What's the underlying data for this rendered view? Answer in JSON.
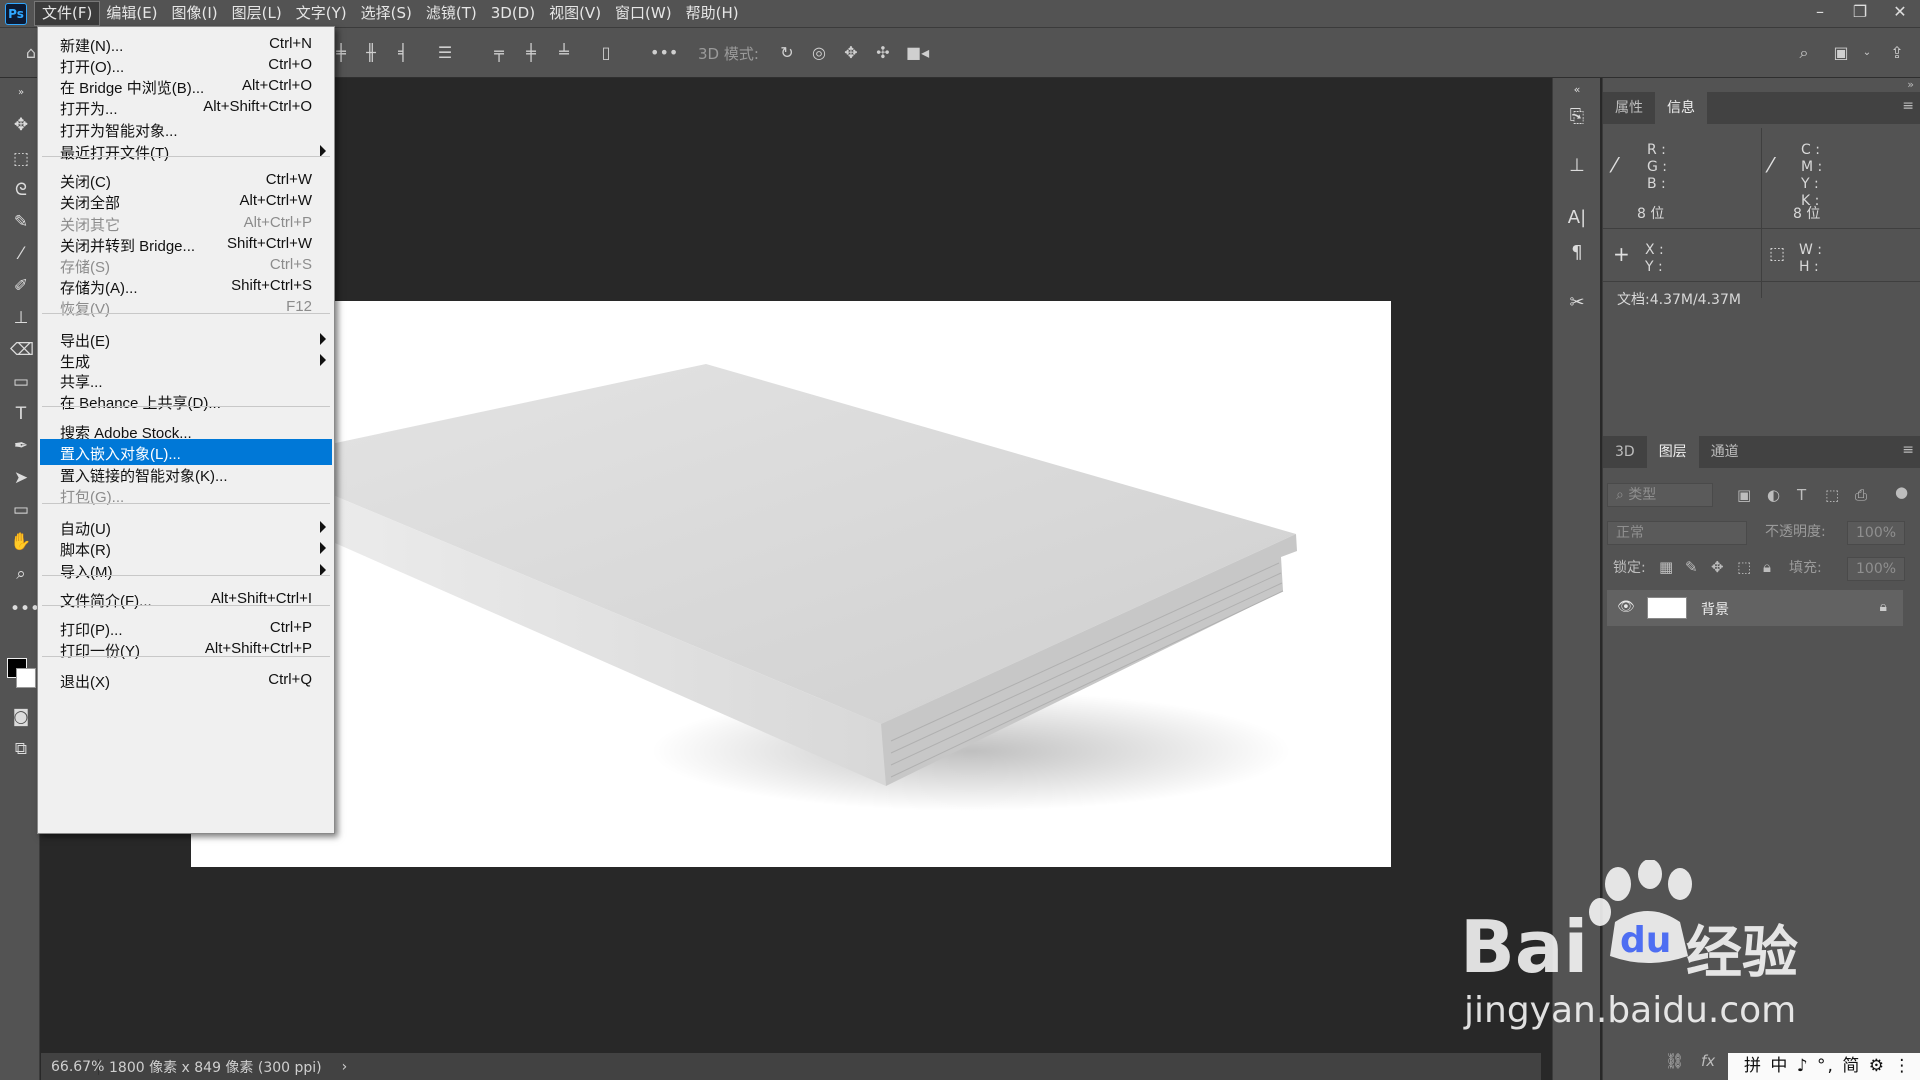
{
  "menubar": {
    "logo": "Ps",
    "items": [
      "文件(F)",
      "编辑(E)",
      "图像(I)",
      "图层(L)",
      "文字(Y)",
      "选择(S)",
      "滤镜(T)",
      "3D(D)",
      "视图(V)",
      "窗口(W)",
      "帮助(H)"
    ],
    "active": "文件(F)",
    "window_controls": [
      "minimize",
      "restore",
      "close"
    ]
  },
  "options_bar": {
    "mode_3d_label": "3D 模式:",
    "more": "•••"
  },
  "file_menu": {
    "items": [
      {
        "label": "新建(N)...",
        "shortcut": "Ctrl+N",
        "disabled": false,
        "submenu": false
      },
      {
        "label": "打开(O)...",
        "shortcut": "Ctrl+O",
        "disabled": false,
        "submenu": false
      },
      {
        "label": "在 Bridge 中浏览(B)...",
        "shortcut": "Alt+Ctrl+O",
        "disabled": false,
        "submenu": false
      },
      {
        "label": "打开为...",
        "shortcut": "Alt+Shift+Ctrl+O",
        "disabled": false,
        "submenu": false
      },
      {
        "label": "打开为智能对象...",
        "shortcut": "",
        "disabled": false,
        "submenu": false
      },
      {
        "label": "最近打开文件(T)",
        "shortcut": "",
        "disabled": false,
        "submenu": true
      },
      {
        "label": "关闭(C)",
        "shortcut": "Ctrl+W",
        "disabled": false,
        "submenu": false
      },
      {
        "label": "关闭全部",
        "shortcut": "Alt+Ctrl+W",
        "disabled": false,
        "submenu": false
      },
      {
        "label": "关闭其它",
        "shortcut": "Alt+Ctrl+P",
        "disabled": true,
        "submenu": false
      },
      {
        "label": "关闭并转到 Bridge...",
        "shortcut": "Shift+Ctrl+W",
        "disabled": false,
        "submenu": false
      },
      {
        "label": "存储(S)",
        "shortcut": "Ctrl+S",
        "disabled": true,
        "submenu": false
      },
      {
        "label": "存储为(A)...",
        "shortcut": "Shift+Ctrl+S",
        "disabled": false,
        "submenu": false
      },
      {
        "label": "恢复(V)",
        "shortcut": "F12",
        "disabled": true,
        "submenu": false
      },
      {
        "label": "导出(E)",
        "shortcut": "",
        "disabled": false,
        "submenu": true
      },
      {
        "label": "生成",
        "shortcut": "",
        "disabled": false,
        "submenu": true
      },
      {
        "label": "共享...",
        "shortcut": "",
        "disabled": false,
        "submenu": false
      },
      {
        "label": "在 Behance 上共享(D)...",
        "shortcut": "",
        "disabled": false,
        "submenu": false
      },
      {
        "label": "搜索 Adobe Stock...",
        "shortcut": "",
        "disabled": false,
        "submenu": false
      },
      {
        "label": "置入嵌入对象(L)...",
        "shortcut": "",
        "disabled": false,
        "submenu": false,
        "selected": true
      },
      {
        "label": "置入链接的智能对象(K)...",
        "shortcut": "",
        "disabled": false,
        "submenu": false
      },
      {
        "label": "打包(G)...",
        "shortcut": "",
        "disabled": true,
        "submenu": false
      },
      {
        "label": "自动(U)",
        "shortcut": "",
        "disabled": false,
        "submenu": true
      },
      {
        "label": "脚本(R)",
        "shortcut": "",
        "disabled": false,
        "submenu": true
      },
      {
        "label": "导入(M)",
        "shortcut": "",
        "disabled": false,
        "submenu": true
      },
      {
        "label": "文件简介(F)...",
        "shortcut": "Alt+Shift+Ctrl+I",
        "disabled": false,
        "submenu": false
      },
      {
        "label": "打印(P)...",
        "shortcut": "Ctrl+P",
        "disabled": false,
        "submenu": false
      },
      {
        "label": "打印一份(Y)",
        "shortcut": "Alt+Shift+Ctrl+P",
        "disabled": false,
        "submenu": false
      },
      {
        "label": "退出(X)",
        "shortcut": "Ctrl+Q",
        "disabled": false,
        "submenu": false
      }
    ]
  },
  "status_bar": {
    "zoom": "66.67%",
    "doc_size": "1800 像素 x 849 像素 (300 ppi)",
    "arrow": "›"
  },
  "info_panel": {
    "tabs": [
      "属性",
      "信息"
    ],
    "active_tab": "信息",
    "rgb_labels": "R :\nG :\nB :",
    "cmyk_labels": "C :\nM :\nY :\nK :",
    "bits_left": "8 位",
    "bits_right": "8 位",
    "xy_labels": "X :\nY :",
    "wh_labels": "W :\nH :",
    "doc_info": "文档:4.37M/4.37M"
  },
  "layers_panel": {
    "tabs": [
      "3D",
      "图层",
      "通道"
    ],
    "active_tab": "图层",
    "filter_placeholder": "类型",
    "blend_mode": "正常",
    "opacity_label": "不透明度:",
    "opacity_value": "100%",
    "lock_label": "锁定:",
    "fill_label": "填充:",
    "fill_value": "100%",
    "layers": [
      {
        "name": "背景",
        "visible": true,
        "locked": true
      }
    ]
  },
  "taskbar_ime": "拼 中 ♪ °, 简 ⚙ ⋮",
  "watermark": {
    "brand": "Bai",
    "brand2": "du",
    "cn": "经验",
    "url": "jingyan.baidu.com"
  }
}
